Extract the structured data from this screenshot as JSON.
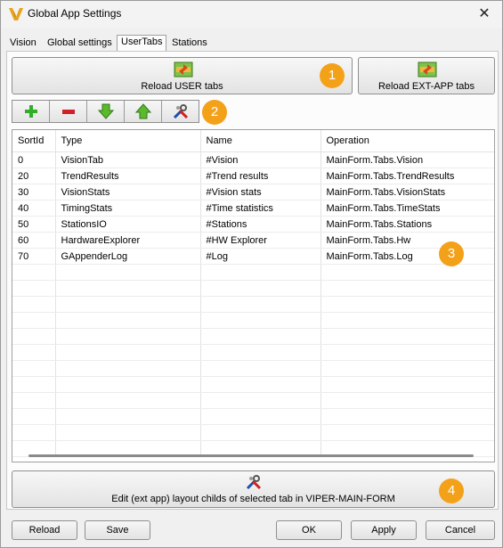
{
  "window": {
    "title": "Global App Settings",
    "close_glyph": "✕"
  },
  "tabs": [
    {
      "label": "Vision",
      "active": false
    },
    {
      "label": "Global settings",
      "active": false
    },
    {
      "label": "UserTabs",
      "active": true
    },
    {
      "label": "Stations",
      "active": false
    }
  ],
  "buttons": {
    "reload_user": "Reload USER tabs",
    "reload_ext": "Reload EXT-APP tabs",
    "edit_layout": "Edit (ext app) layout childs of selected tab in VIPER-MAIN-FORM"
  },
  "toolbar": {
    "icons": [
      "add-icon",
      "remove-icon",
      "move-down-icon",
      "move-up-icon",
      "tools-icon"
    ]
  },
  "badges": [
    "1",
    "2",
    "3",
    "4"
  ],
  "grid": {
    "columns": [
      "SortId",
      "Type",
      "Name",
      "Operation"
    ],
    "rows": [
      [
        "0",
        "VisionTab",
        "#Vision",
        "MainForm.Tabs.Vision"
      ],
      [
        "20",
        "TrendResults",
        "#Trend results",
        "MainForm.Tabs.TrendResults"
      ],
      [
        "30",
        "VisionStats",
        "#Vision stats",
        "MainForm.Tabs.VisionStats"
      ],
      [
        "40",
        "TimingStats",
        "#Time statistics",
        "MainForm.Tabs.TimeStats"
      ],
      [
        "50",
        "StationsIO",
        "#Stations",
        "MainForm.Tabs.Stations"
      ],
      [
        "60",
        "HardwareExplorer",
        "#HW Explorer",
        "MainForm.Tabs.Hw"
      ],
      [
        "70",
        "GAppenderLog",
        "#Log",
        "MainForm.Tabs.Log"
      ]
    ]
  },
  "footer": {
    "reload": "Reload",
    "save": "Save",
    "ok": "OK",
    "apply": "Apply",
    "cancel": "Cancel"
  },
  "colors": {
    "badge": "#f4a11a",
    "accent": "#0067c0"
  }
}
